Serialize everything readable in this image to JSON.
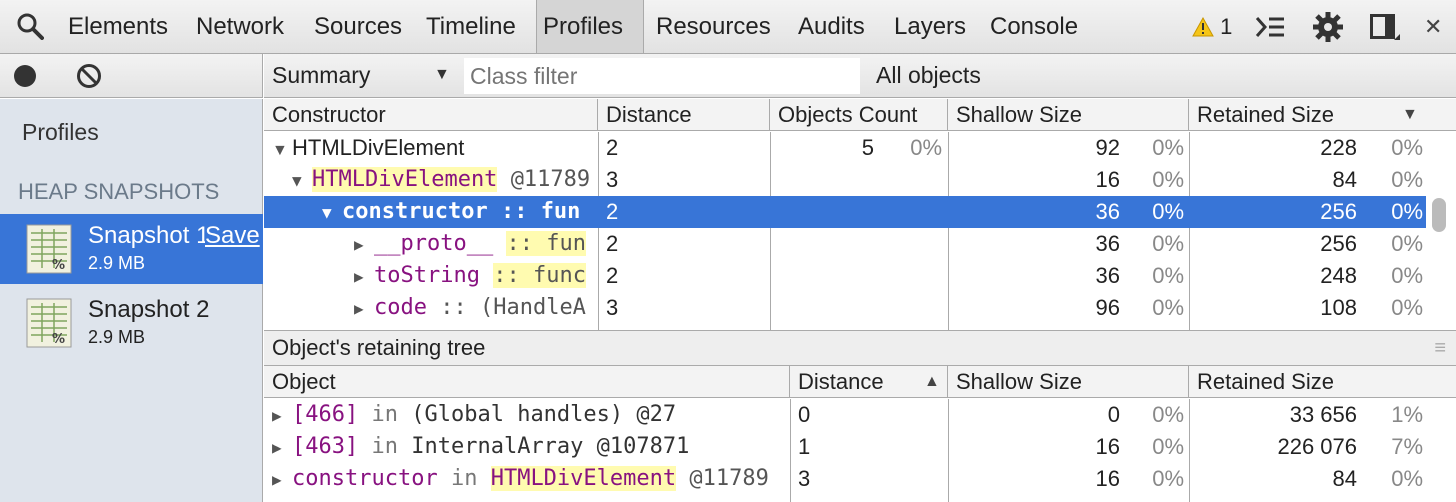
{
  "toolbar": {
    "tabs": [
      "Elements",
      "Network",
      "Sources",
      "Timeline",
      "Profiles",
      "Resources",
      "Audits",
      "Layers",
      "Console"
    ],
    "active_tab": "Profiles",
    "warning_count": "1"
  },
  "subbar": {
    "view": "Summary",
    "class_filter_placeholder": "Class filter",
    "scope": "All objects"
  },
  "sidebar": {
    "profiles_label": "Profiles",
    "section_label": "HEAP SNAPSHOTS",
    "snapshots": [
      {
        "title": "Snapshot 1",
        "size": "2.9 MB",
        "save_label": "Save"
      },
      {
        "title": "Snapshot 2",
        "size": "2.9 MB"
      }
    ]
  },
  "constructor_grid": {
    "columns": [
      "Constructor",
      "Distance",
      "Objects Count",
      "Shallow Size",
      "Retained Size"
    ],
    "rows": [
      {
        "name": "HTMLDivElement",
        "suffix": "",
        "distance": "2",
        "count": "5",
        "count_pct": "0%",
        "shallow": "92",
        "shallow_pct": "0%",
        "retained": "228",
        "retained_pct": "0%"
      },
      {
        "name": "HTMLDivElement",
        "suffix": "@11789",
        "distance": "3",
        "count": "",
        "count_pct": "",
        "shallow": "16",
        "shallow_pct": "0%",
        "retained": "84",
        "retained_pct": "0%"
      },
      {
        "name": "constructor",
        "suffix": ":: fun",
        "distance": "2",
        "count": "",
        "count_pct": "",
        "shallow": "36",
        "shallow_pct": "0%",
        "retained": "256",
        "retained_pct": "0%"
      },
      {
        "name": "__proto__",
        "suffix": ":: fun",
        "distance": "2",
        "count": "",
        "count_pct": "",
        "shallow": "36",
        "shallow_pct": "0%",
        "retained": "256",
        "retained_pct": "0%"
      },
      {
        "name": "toString",
        "suffix": ":: func",
        "distance": "2",
        "count": "",
        "count_pct": "",
        "shallow": "36",
        "shallow_pct": "0%",
        "retained": "248",
        "retained_pct": "0%"
      },
      {
        "name": "code",
        "suffix": ":: (HandleA",
        "distance": "3",
        "count": "",
        "count_pct": "",
        "shallow": "96",
        "shallow_pct": "0%",
        "retained": "108",
        "retained_pct": "0%"
      }
    ]
  },
  "retaining_tree": {
    "title": "Object's retaining tree",
    "columns": [
      "Object",
      "Distance",
      "Shallow Size",
      "Retained Size"
    ],
    "rows": [
      {
        "id": "[466]",
        "in": "in",
        "target": "(Global handles) @27",
        "distance": "0",
        "shallow": "0",
        "shallow_pct": "0%",
        "retained": "33 656",
        "retained_pct": "1%"
      },
      {
        "id": "[463]",
        "in": "in",
        "target": "InternalArray @107871",
        "distance": "1",
        "shallow": "16",
        "shallow_pct": "0%",
        "retained": "226 076",
        "retained_pct": "7%"
      },
      {
        "id": "constructor",
        "in": "in",
        "target": "HTMLDivElement",
        "target_suffix": "@11789",
        "distance": "3",
        "shallow": "16",
        "shallow_pct": "0%",
        "retained": "84",
        "retained_pct": "0%"
      }
    ]
  }
}
